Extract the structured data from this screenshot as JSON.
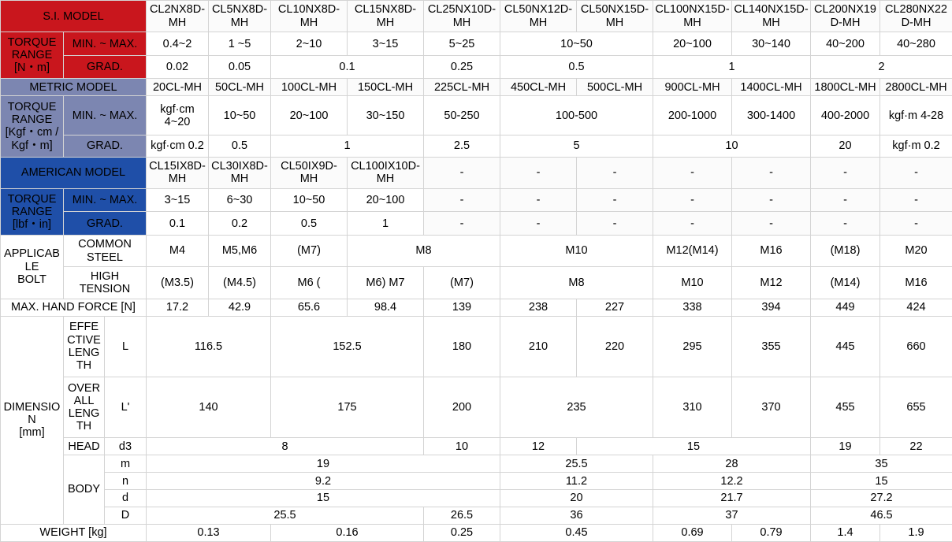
{
  "table": {
    "sections": {
      "si_model_label": "S.I. MODEL",
      "metric_model_label": "METRIC MODEL",
      "american_model_label": "AMERICAN MODEL",
      "torque_range": "TORQUE RANGE",
      "unit_si": "[N・m]",
      "unit_metric_1": "[Kgf・cm /",
      "unit_metric_2": "Kgf・m]",
      "unit_us": "[lbf・in]",
      "min_max": "MIN. ~ MAX.",
      "grad": "GRAD.",
      "applicable_bolt_1": "APPLICABLE",
      "applicable_bolt_2": "BOLT",
      "common_steel_1": "COMMON",
      "common_steel_2": "STEEL",
      "high_tension_1": "HIGH",
      "high_tension_2": "TENSION",
      "max_hand_force": "MAX. HAND FORCE [N]",
      "dimension_1": "DIMENSION",
      "dimension_2": "[mm]",
      "effective_length_1": "EFFECTIVE",
      "effective_length_2": "LENGTH",
      "overall_length_1": "OVERALL",
      "overall_length_2": "LENGTH",
      "head": "HEAD",
      "body": "BODY",
      "sym_L": "L",
      "sym_Lp": "L'",
      "sym_d3": "d3",
      "sym_m": "m",
      "sym_n": "n",
      "sym_d": "d",
      "sym_D": "D",
      "weight": "WEIGHT [kg]"
    },
    "si_models": [
      "CL2NX8D-MH",
      "CL5NX8D-MH",
      "CL10NX8D-MH",
      "CL15NX8D-MH",
      "CL25NX10D-MH",
      "CL50NX12D-MH",
      "CL50NX15D-MH",
      "CL100NX15D-MH",
      "CL140NX15D-MH",
      "CL200NX19D-MH",
      "CL280NX22D-MH"
    ],
    "si_torque_minmax": [
      "0.4~2",
      "1 ~5",
      "2~10",
      "3~15",
      "5~25",
      "10~50",
      "20~100",
      "30~140",
      "40~200",
      "40~280"
    ],
    "si_torque_grad": [
      "0.02",
      "0.05",
      "0.1",
      "0.25",
      "0.5",
      "1",
      "2"
    ],
    "metric_models": [
      "20CL-MH",
      "50CL-MH",
      "100CL-MH",
      "150CL-MH",
      "225CL-MH",
      "450CL-MH",
      "500CL-MH",
      "900CL-MH",
      "1400CL-MH",
      "1800CL-MH",
      "2800CL-MH"
    ],
    "metric_torque_minmax": [
      "kgf·cm 4~20",
      "10~50",
      "20~100",
      "30~150",
      "50-250",
      "100-500",
      "200-1000",
      "300-1400",
      "400-2000",
      "kgf·m 4-28"
    ],
    "metric_torque_grad": [
      "kgf·cm 0.2",
      "0.5",
      "1",
      "2.5",
      "5",
      "10",
      "20",
      "kgf·m 0.2"
    ],
    "american_models": [
      "CL15IX8D-MH",
      "CL30IX8D-MH",
      "CL50IX9D-MH",
      "CL100IX10D-MH",
      "-",
      "-",
      "-",
      "-",
      "-",
      "-",
      "-"
    ],
    "us_torque_minmax": [
      "3~15",
      "6~30",
      "10~50",
      "20~100",
      "-",
      "-",
      "-",
      "-",
      "-",
      "-",
      "-"
    ],
    "us_torque_grad": [
      "0.1",
      "0.2",
      "0.5",
      "1",
      "-",
      "-",
      "-",
      "-",
      "-",
      "-",
      "-"
    ],
    "bolt_common_steel": [
      "M4",
      "M5,M6",
      "(M7)",
      "M8",
      "M10",
      "M12(M14)",
      "M16",
      "(M18)",
      "M20"
    ],
    "bolt_high_tension": [
      "(M3.5)",
      "(M4.5)",
      "M6 (",
      "M6) M7",
      "(M7)",
      "M8",
      "M10",
      "M12",
      "(M14)",
      "M16"
    ],
    "max_hand_force": [
      "17.2",
      "42.9",
      "65.6",
      "98.4",
      "139",
      "238",
      "227",
      "338",
      "394",
      "449",
      "424"
    ],
    "effective_length": [
      "116.5",
      "152.5",
      "180",
      "210",
      "220",
      "295",
      "355",
      "445",
      "660"
    ],
    "overall_length": [
      "140",
      "175",
      "200",
      "235",
      "310",
      "370",
      "455",
      "655"
    ],
    "head_d3": [
      "8",
      "10",
      "12",
      "15",
      "19",
      "22"
    ],
    "body_m": [
      "19",
      "25.5",
      "28",
      "35"
    ],
    "body_n": [
      "9.2",
      "11.2",
      "12.2",
      "15"
    ],
    "body_d": [
      "15",
      "20",
      "21.7",
      "27.2"
    ],
    "body_D": [
      "25.5",
      "26.5",
      "36",
      "37",
      "46.5"
    ],
    "weight": [
      "0.13",
      "0.16",
      "0.25",
      "0.45",
      "0.69",
      "0.79",
      "1.4",
      "1.9"
    ]
  },
  "colors": {
    "si_red": "#c9161d",
    "metric_slate": "#7c86b1",
    "american_blue": "#1f4fa8",
    "grid": "#d4d4d4"
  }
}
